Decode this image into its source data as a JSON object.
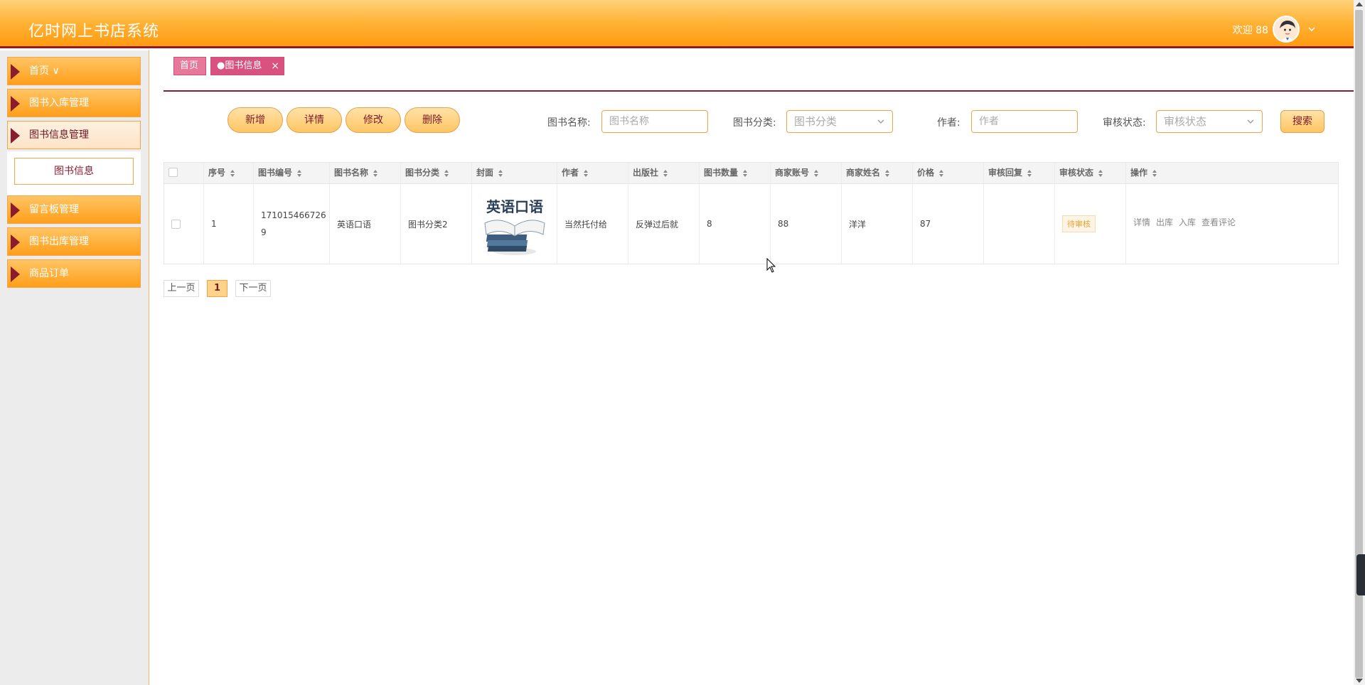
{
  "header": {
    "title": "亿时网上书店系统",
    "welcome": "欢迎 88"
  },
  "sidebar": {
    "items": [
      {
        "label": "首页 ∨"
      },
      {
        "label": "图书入库管理"
      },
      {
        "label": "图书信息管理"
      },
      {
        "label": "留言板管理"
      },
      {
        "label": "图书出库管理"
      },
      {
        "label": "商品订单"
      }
    ],
    "submenu": {
      "label": "图书信息"
    }
  },
  "tabs": {
    "home": "首页",
    "book": "●图书信息",
    "close": "×"
  },
  "toolbar": {
    "add": "新增",
    "detail": "详情",
    "edit": "修改",
    "delete": "删除"
  },
  "search": {
    "name_label": "图书名称:",
    "name_placeholder": "图书名称",
    "category_label": "图书分类:",
    "category_placeholder": "图书分类",
    "author_label": "作者:",
    "author_placeholder": "作者",
    "status_label": "审核状态:",
    "status_placeholder": "审核状态",
    "search_button": "搜索"
  },
  "table": {
    "headers": [
      "序号",
      "图书编号",
      "图书名称",
      "图书分类",
      "封面",
      "作者",
      "出版社",
      "图书数量",
      "商家账号",
      "商家姓名",
      "价格",
      "审核回复",
      "审核状态",
      "操作"
    ],
    "rows": [
      {
        "index": "1",
        "book_no_line1": "171015466726",
        "book_no_line2": "9",
        "name": "英语口语",
        "category": "图书分类2",
        "cover_text": "英语口语",
        "author": "当然托付给",
        "publisher": "反弹过后就",
        "quantity": "8",
        "merchant_account": "88",
        "merchant_name": "洋洋",
        "price": "87",
        "reply": "",
        "status": "待审核",
        "ops": [
          "详情",
          "出库",
          "入库",
          "查看评论"
        ]
      }
    ]
  },
  "pager": {
    "prev": "上一页",
    "current": "1",
    "next": "下一页"
  },
  "colors": {
    "accent_orange": "#ff9f1a",
    "accent_maroon": "#8a1c2e",
    "tab_pink": "#d9527f"
  }
}
